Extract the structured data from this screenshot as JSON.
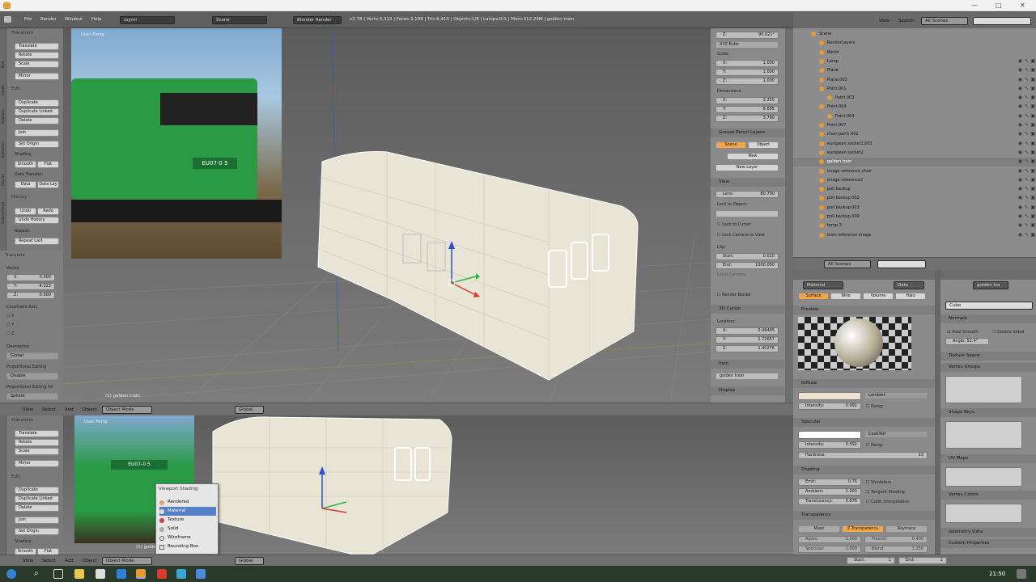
{
  "topbar": {
    "menus": [
      "File",
      "Render",
      "Window",
      "Help"
    ],
    "screen_layout": "szymi",
    "scene": "Scene",
    "engine": "Blender Render",
    "stats": "v2.78 | Verts:3,312 | Faces:3,199 | Tris:6,410 | Objects:1/8 | Lamps:0/1 | Mem:312.24M | golden train"
  },
  "tool_shelf": {
    "transform_header": "Transform",
    "translate": "Translate",
    "rotate": "Rotate",
    "scale": "Scale",
    "mirror": "Mirror",
    "edit_header": "Edit",
    "duplicate": "Duplicate",
    "duplicate_linked": "Duplicate Linked",
    "delete": "Delete",
    "join": "Join",
    "set_origin": "Set Origin",
    "shading_label": "Shading:",
    "smooth": "Smooth",
    "flat": "Flat",
    "data_transfer_label": "Data Transfer:",
    "data": "Data",
    "data_lay": "Data Lay",
    "history_header": "History",
    "undo": "Undo",
    "redo": "Redo",
    "undo_history": "Undo History",
    "repeat_label": "Repeat:",
    "repeat_last": "Repeat Last"
  },
  "vertical_tabs": [
    "Tools",
    "Create",
    "Relations",
    "Animation",
    "Physics",
    "Grease Pencil"
  ],
  "operator_panel": {
    "header": "Translate",
    "vector_label": "Vector",
    "x": "X:",
    "x_val": "0.000",
    "y": "Y:",
    "y_val": "-4.223",
    "z": "Z:",
    "z_val": "0.000",
    "constraint_label": "Constraint Axis",
    "cx": "X",
    "cy": "Y",
    "cz": "Z",
    "orientation_label": "Orientation",
    "orientation": "Global",
    "prop_edit_label": "Proportional Editing",
    "prop_edit": "Disable",
    "prop_falloff_label": "Proportional Editing Fal",
    "prop_falloff": "Sphere"
  },
  "viewport_top": {
    "view_label": "User Persp",
    "object_label": "(1) golden train"
  },
  "viewport_bottom": {
    "view_label": "User Persp",
    "object_label": "(1) golden train"
  },
  "header_top": {
    "menus": [
      "View",
      "Select",
      "Add",
      "Object"
    ],
    "mode": "Object Mode",
    "orientation": "Global"
  },
  "header_bottom": {
    "menus": [
      "View",
      "Select",
      "Add",
      "Object"
    ],
    "mode": "Object Mode",
    "orientation": "Global"
  },
  "photo": {
    "loco_number": "EU07-0 5"
  },
  "shading_menu": {
    "title": "Viewport Shading",
    "items": [
      "Rendered",
      "Material",
      "Texture",
      "Solid",
      "Wireframe",
      "Bounding Box"
    ]
  },
  "npanel": {
    "rot_z": "Z:",
    "rot_z_val": "90.021°",
    "rot_mode": "XYZ Euler",
    "scale_label": "Scale:",
    "sx": "X:",
    "sx_val": "1.000",
    "sy": "Y:",
    "sy_val": "1.000",
    "sz": "Z:",
    "sz_val": "1.000",
    "dim_label": "Dimensions:",
    "dx": "X:",
    "dx_val": "3.250",
    "dy": "Y:",
    "dy_val": "8.895",
    "dz": "Z:",
    "dz_val": "3.790",
    "gp_header": "Grease Pencil Layers",
    "gp_scene": "Scene",
    "gp_object": "Object",
    "gp_new": "New",
    "gp_new_layer": "New Layer",
    "view_header": "View",
    "lens_label": "Lens:",
    "lens_val": "80.700",
    "lock_obj_label": "Lock to Object:",
    "lock_cursor": "Lock to Cursor",
    "lock_camera": "Lock Camera to View",
    "clip_label": "Clip:",
    "clip_start": "Start:",
    "clip_start_val": "0.010",
    "clip_end": "End:",
    "clip_end_val": "1000.000",
    "local_camera": "Local Camera:",
    "render_border": "Render Border",
    "cursor_header": "3D Cursor",
    "loc_label": "Location:",
    "cx": "X:",
    "cx_val": "0.08485",
    "cy": "Y:",
    "cy_val": "1.72657",
    "cz": "Z:",
    "cz_val": "1.40276",
    "item_header": "Item",
    "item_name": "golden train",
    "display_header": "Display"
  },
  "outliner": {
    "menus": [
      "View",
      "Search"
    ],
    "filter": "All Scenes",
    "rows": [
      {
        "name": "Scene",
        "indent": 0
      },
      {
        "name": "RenderLayers",
        "indent": 1
      },
      {
        "name": "World",
        "indent": 1
      },
      {
        "name": "Lamp",
        "indent": 1
      },
      {
        "name": "Plane",
        "indent": 1
      },
      {
        "name": "Plane.003",
        "indent": 1
      },
      {
        "name": "Point.001",
        "indent": 1
      },
      {
        "name": "Point.003",
        "indent": 2
      },
      {
        "name": "Point.004",
        "indent": 1
      },
      {
        "name": "Point.004",
        "indent": 2
      },
      {
        "name": "Point.007",
        "indent": 1
      },
      {
        "name": "chair part1.001",
        "indent": 1
      },
      {
        "name": "european socket1.001",
        "indent": 1
      },
      {
        "name": "european socket2",
        "indent": 1
      },
      {
        "name": "golden train",
        "indent": 1
      },
      {
        "name": "image reference chair",
        "indent": 1
      },
      {
        "name": "image reference2",
        "indent": 1
      },
      {
        "name": "poli backup",
        "indent": 1
      },
      {
        "name": "poli backup.002",
        "indent": 1
      },
      {
        "name": "poli backup.003",
        "indent": 1
      },
      {
        "name": "poli backup.009",
        "indent": 1
      },
      {
        "name": "temp 3",
        "indent": 1
      },
      {
        "name": "train reference image",
        "indent": 1
      }
    ],
    "bottom_filter": "All Scenes"
  },
  "material": {
    "tab_label": "Material",
    "data_label": "Data",
    "tabs": [
      "Surface",
      "Wire",
      "Volume",
      "Halo"
    ],
    "preview_header": "Preview",
    "diffuse_header": "Diffuse",
    "diffuse_shader": "Lambert",
    "diffuse_intensity_label": "Intensity:",
    "diffuse_intensity": "0.991",
    "ramp": "Ramp",
    "specular_header": "Specular",
    "spec_shader": "CookTorr",
    "spec_intensity_label": "Intensity:",
    "spec_intensity": "0.592",
    "hardness_label": "Hardness:",
    "hardness": "13",
    "shading_header": "Shading",
    "emit_label": "Emit:",
    "emit": "0.76",
    "ambient_label": "Ambient:",
    "ambient": "1.000",
    "translucency_label": "Translucency:",
    "translucency": "0.876",
    "shadeless": "Shadeless",
    "tangent_shading": "Tangent Shading",
    "cubic_interp": "Cubic Interpolation",
    "transparency_header": "Transparency",
    "mask": "Mask",
    "ztransp": "Z Transparency",
    "raytrace": "Raytrace",
    "alpha_label": "Alpha:",
    "alpha": "1.000",
    "fresnel_label": "Fresnel:",
    "fresnel": "0.400",
    "specular_label": "Specular:",
    "specular": "1.000",
    "blend_label": "Blend:",
    "blend": "1.250"
  },
  "data_props": {
    "object_name": "golden tra",
    "mesh_name": "Cube",
    "normals_header": "Normals",
    "auto_smooth": "Auto Smooth",
    "double_sided": "Double Sided",
    "angle": "Angle: 52.4°",
    "texture_space": "Texture Space",
    "vertex_groups": "Vertex Groups",
    "shape_keys": "Shape Keys",
    "uv_maps": "UV Maps",
    "vertex_colors": "Vertex Colors",
    "geometry_data": "Geometry Data",
    "custom_props": "Custom Properties"
  },
  "timeline": {
    "start_label": "Start:",
    "start": "1",
    "end_label": "End:",
    "end": "1"
  },
  "taskbar": {
    "clock": "21:50"
  },
  "colors": {
    "accent_orange": "#e59a3a",
    "selected_tab": "#f0a64a",
    "viewport_bg": "#6d6d6d"
  }
}
